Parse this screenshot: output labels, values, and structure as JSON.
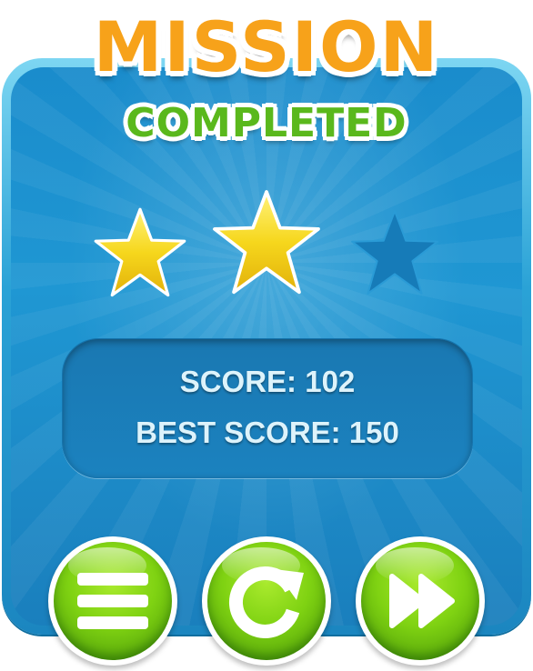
{
  "title": {
    "line1": "MISSION",
    "line2": "COMPLETED"
  },
  "stars": {
    "earned": 2,
    "total": 3
  },
  "score": {
    "current_label": "SCORE: 102",
    "best_label": "BEST SCORE: 150"
  },
  "buttons": [
    {
      "name": "menu",
      "icon": "menu-icon"
    },
    {
      "name": "restart",
      "icon": "restart-icon"
    },
    {
      "name": "next",
      "icon": "fast-forward-icon"
    }
  ],
  "colors": {
    "panel_blue": "#1f97d3",
    "title_orange": "#f7a21a",
    "title_green": "#5ab81c",
    "star_gold": "#f4d21c",
    "button_green": "#7fd212"
  }
}
